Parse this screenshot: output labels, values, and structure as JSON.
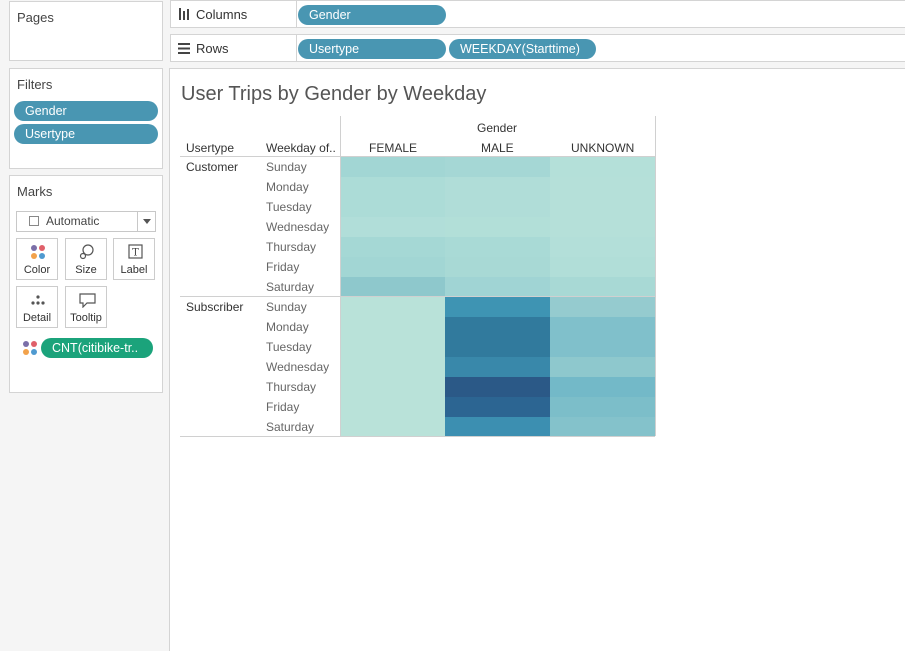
{
  "pages": {
    "title": "Pages"
  },
  "filters": {
    "title": "Filters",
    "items": [
      "Gender",
      "Usertype"
    ]
  },
  "marks": {
    "title": "Marks",
    "mark_type": "Automatic",
    "buttons": {
      "color": "Color",
      "size": "Size",
      "label": "Label",
      "detail": "Detail",
      "tooltip": "Tooltip"
    },
    "color_field": "CNT(citibike-tr.."
  },
  "shelves": {
    "columns_label": "Columns",
    "columns_pills": [
      "Gender"
    ],
    "rows_label": "Rows",
    "rows_pills": [
      "Usertype",
      "WEEKDAY(Starttime)"
    ]
  },
  "view": {
    "title": "User Trips by Gender by Weekday",
    "column_group_header": "Gender",
    "row_header_1": "Usertype",
    "row_header_2": "Weekday of..",
    "columns": [
      "FEMALE",
      "MALE",
      "UNKNOWN"
    ],
    "row_groups": [
      {
        "name": "Customer",
        "days": [
          "Sunday",
          "Monday",
          "Tuesday",
          "Wednesday",
          "Thursday",
          "Friday",
          "Saturday"
        ]
      },
      {
        "name": "Subscriber",
        "days": [
          "Sunday",
          "Monday",
          "Tuesday",
          "Wednesday",
          "Thursday",
          "Friday",
          "Saturday"
        ]
      }
    ]
  },
  "colors": {
    "pill_blue": "#4996b2",
    "pill_green": "#1ba37b",
    "heatmap": {
      "Customer": [
        [
          "#a2d6d4",
          "#a5d7d5",
          "#b4e0d9"
        ],
        [
          "#acdcd7",
          "#b0ddd8",
          "#b5e0d9"
        ],
        [
          "#acdcd7",
          "#b0ddd8",
          "#b5e0d9"
        ],
        [
          "#b1ded9",
          "#b2dfd8",
          "#b5e0d9"
        ],
        [
          "#a5d8d5",
          "#a9dad6",
          "#b3dfd9"
        ],
        [
          "#a2d6d4",
          "#a8d9d5",
          "#b1ded8"
        ],
        [
          "#8ec8cc",
          "#a0d4d4",
          "#a8d9d5"
        ]
      ],
      "Subscriber": [
        [
          "#b9e2d9",
          "#3e94b3",
          "#95cbcf"
        ],
        [
          "#b9e2d9",
          "#317a9d",
          "#80c0cb"
        ],
        [
          "#b9e2d9",
          "#317a9d",
          "#80c0cb"
        ],
        [
          "#b9e2d9",
          "#3988aa",
          "#8ec8cd"
        ],
        [
          "#b9e2d9",
          "#2b5987",
          "#73b9c8"
        ],
        [
          "#b9e2d9",
          "#2c6592",
          "#7cbec9"
        ],
        [
          "#b9e2d9",
          "#3c8fb1",
          "#84c2cb"
        ]
      ]
    }
  }
}
